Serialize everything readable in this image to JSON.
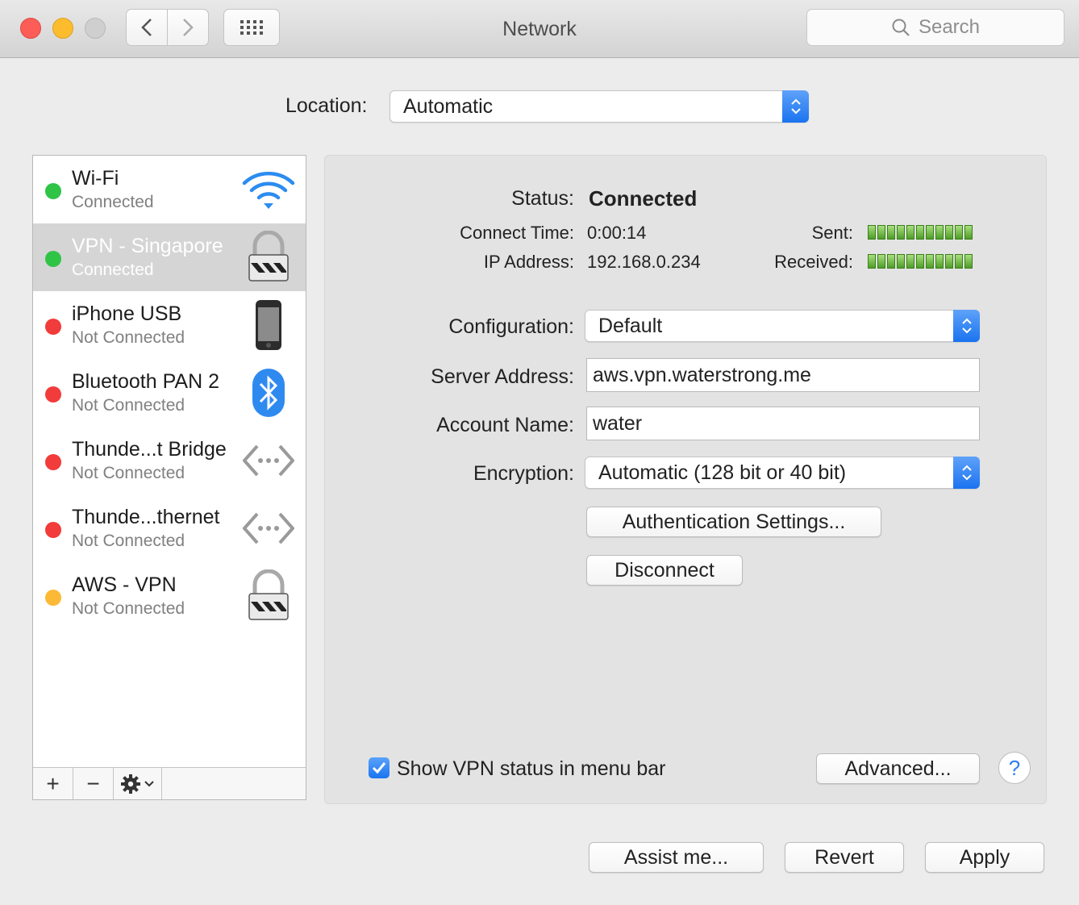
{
  "window": {
    "title": "Network"
  },
  "toolbar": {
    "search_placeholder": "Search"
  },
  "location": {
    "label": "Location:",
    "value": "Automatic"
  },
  "services": [
    {
      "name": "Wi-Fi",
      "status": "Connected",
      "dot": "#2fc446",
      "icon": "wifi-icon"
    },
    {
      "name": "VPN - Singapore",
      "status": "Connected",
      "dot": "#2fc446",
      "icon": "vpn-lock-icon",
      "selected": true
    },
    {
      "name": "iPhone USB",
      "status": "Not Connected",
      "dot": "#f23b3b",
      "icon": "iphone-icon"
    },
    {
      "name": "Bluetooth PAN 2",
      "status": "Not Connected",
      "dot": "#f23b3b",
      "icon": "bluetooth-icon"
    },
    {
      "name": "Thunde...t Bridge",
      "status": "Not Connected",
      "dot": "#f23b3b",
      "icon": "thunderbolt-bridge-icon"
    },
    {
      "name": "Thunde...thernet",
      "status": "Not Connected",
      "dot": "#f23b3b",
      "icon": "thunderbolt-ethernet-icon"
    },
    {
      "name": "AWS - VPN",
      "status": "Not Connected",
      "dot": "#fbb935",
      "icon": "vpn-lock-icon"
    }
  ],
  "sidebar_buttons": {
    "add": "+",
    "remove": "−"
  },
  "detail": {
    "status_label": "Status:",
    "status_value": "Connected",
    "connect_time_label": "Connect Time:",
    "connect_time_value": "0:00:14",
    "ip_label": "IP Address:",
    "ip_value": "192.168.0.234",
    "sent_label": "Sent:",
    "received_label": "Received:",
    "sent_level": 1.0,
    "received_level": 1.0,
    "configuration_label": "Configuration:",
    "configuration_value": "Default",
    "server_label": "Server Address:",
    "server_value": "aws.vpn.waterstrong.me",
    "account_label": "Account Name:",
    "account_value": "water",
    "encryption_label": "Encryption:",
    "encryption_value": "Automatic (128 bit or 40 bit)",
    "auth_button": "Authentication Settings...",
    "disconnect_button": "Disconnect",
    "show_vpn_label": "Show VPN status in menu bar",
    "show_vpn_checked": true,
    "advanced_button": "Advanced...",
    "help_button": "?"
  },
  "footer": {
    "assist": "Assist me...",
    "revert": "Revert",
    "apply": "Apply"
  },
  "colors": {
    "accent": "#1a73ef",
    "green": "#2fc446",
    "red": "#f23b3b",
    "yellow": "#fbb935"
  }
}
